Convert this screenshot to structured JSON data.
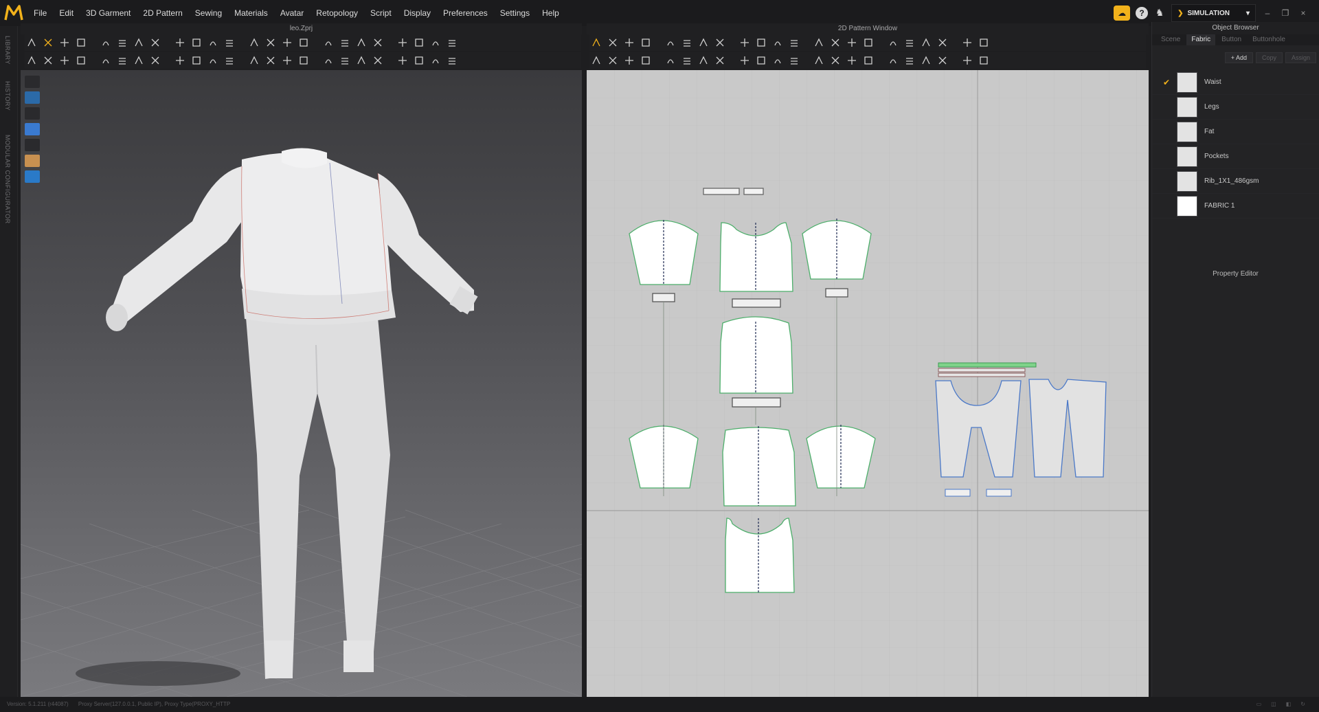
{
  "menu": [
    "File",
    "Edit",
    "3D Garment",
    "2D Pattern",
    "Sewing",
    "Materials",
    "Avatar",
    "Retopology",
    "Script",
    "Display",
    "Preferences",
    "Settings",
    "Help"
  ],
  "mode": "SIMULATION",
  "side_tabs": [
    "LIBRARY",
    "HISTORY",
    "MODULAR CONFIGURATOR"
  ],
  "view3d_title": "leo.Zprj",
  "view2d_title": "2D Pattern Window",
  "right_panel": {
    "object_browser": "Object Browser",
    "tabs": [
      "Scene",
      "Fabric",
      "Button",
      "Buttonhole"
    ],
    "active_tab": "Fabric",
    "add": "+ Add",
    "copy": "Copy",
    "assign": "Assign",
    "fabrics": [
      {
        "name": "Waist",
        "checked": true
      },
      {
        "name": "Legs",
        "checked": false
      },
      {
        "name": "Fat",
        "checked": false
      },
      {
        "name": "Pockets",
        "checked": false
      },
      {
        "name": "Rib_1X1_486gsm",
        "checked": false
      },
      {
        "name": "FABRIC 1",
        "checked": false
      }
    ],
    "property_editor": "Property Editor"
  },
  "status": {
    "version": "Version: 5.1.211 (r44087)",
    "proxy": "Proxy Server(127.0.0.1, Public IP), Proxy Type(PROXY_HTTP"
  },
  "colors": {
    "accent": "#f2b21b",
    "pattern_fill": "#ffffff",
    "pattern_outline_green": "#4cae6a",
    "pattern_outline_blue": "#4a78c8",
    "seam_dashed": "#1d2a52"
  }
}
